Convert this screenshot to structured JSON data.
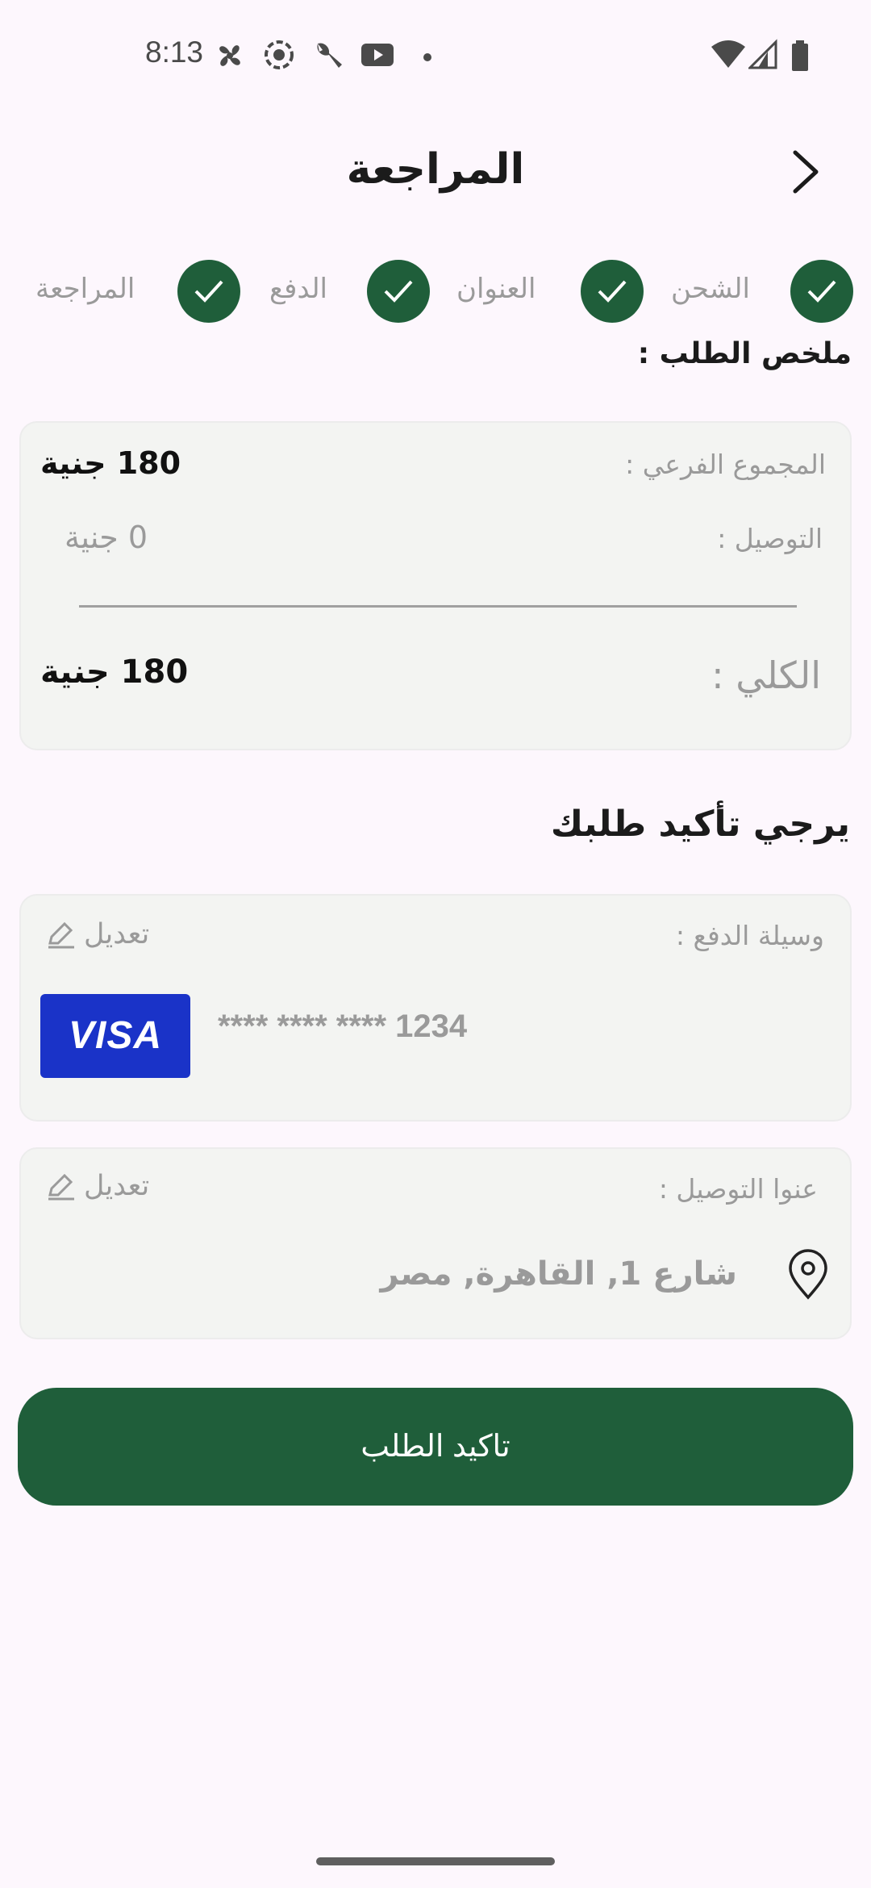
{
  "status_bar": {
    "time": "8:13",
    "left_icons": [
      "fan-icon",
      "record-icon",
      "wrench-icon",
      "youtube-icon",
      "dot-icon"
    ],
    "right_icons": [
      "wifi-icon",
      "signal-icon",
      "battery-icon"
    ]
  },
  "header": {
    "title": "المراجعة",
    "back_icon": "chevron-right-icon"
  },
  "stepper": {
    "steps": [
      {
        "label": "الشحن",
        "done": true
      },
      {
        "label": "العنوان",
        "done": true
      },
      {
        "label": "الدفع",
        "done": true
      },
      {
        "label": "المراجعة",
        "done": true
      }
    ]
  },
  "summary": {
    "heading": "ملخص الطلب :",
    "subtotal_label": "المجموع الفرعي :",
    "subtotal_value": "180 جنية",
    "delivery_label": "التوصيل :",
    "delivery_value": "0 جنية",
    "total_label": "الكلي :",
    "total_value": "180 جنية"
  },
  "confirm_heading": "يرجي تأكيد  طلبك",
  "payment": {
    "label": "وسيلة الدفع :",
    "edit_label": "تعديل",
    "card_brand": "VISA",
    "masked_number": "**** **** **** 1234"
  },
  "address": {
    "label": "عنوا التوصيل :",
    "edit_label": "تعديل",
    "value": "شارع 1, القاهرة, مصر"
  },
  "confirm_button": "تاكيد الطلب",
  "colors": {
    "accent": "#1f5e3a",
    "background": "#fdf7fd",
    "card": "#f3f4f2",
    "muted_text": "#9a9a9a",
    "visa_blue": "#1a33c8"
  }
}
